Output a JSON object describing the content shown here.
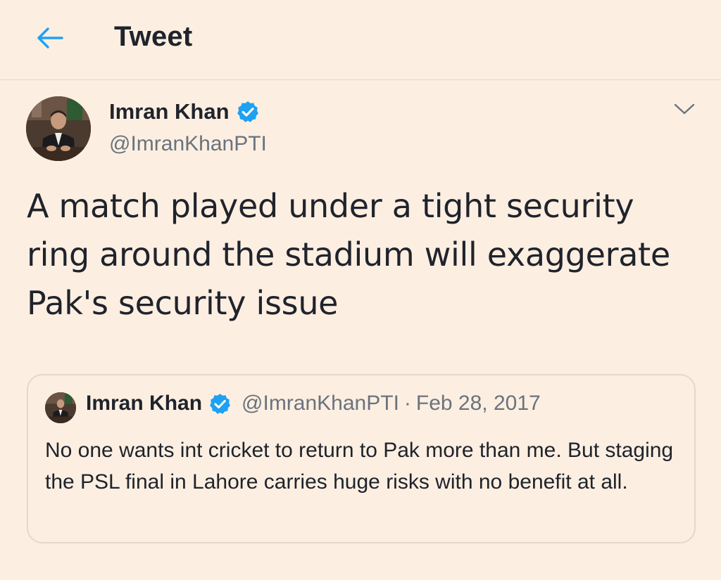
{
  "header": {
    "title": "Tweet",
    "back_icon": "arrow-left-icon",
    "accent_color": "#1da1f2"
  },
  "tweet": {
    "author": {
      "name": "Imran Khan",
      "handle": "@ImranKhanPTI",
      "verified": true,
      "verified_icon": "verified-badge-icon"
    },
    "menu_icon": "chevron-down-icon",
    "text": "A match played under a tight security ring around the stadium will exaggerate Pak's security issue",
    "quoted": {
      "author": {
        "name": "Imran Khan",
        "handle": "@ImranKhanPTI",
        "verified": true
      },
      "separator": "·",
      "date": "Feb 28, 2017",
      "text": "No one wants int cricket to return to Pak more than me. But staging the PSL final in Lahore carries huge risks with no benefit at all."
    }
  },
  "colors": {
    "background": "#fcefe2",
    "text_primary": "#20232b",
    "text_secondary": "#6a737c",
    "verified_blue": "#1da1f2",
    "border": "#e3d8cd"
  }
}
